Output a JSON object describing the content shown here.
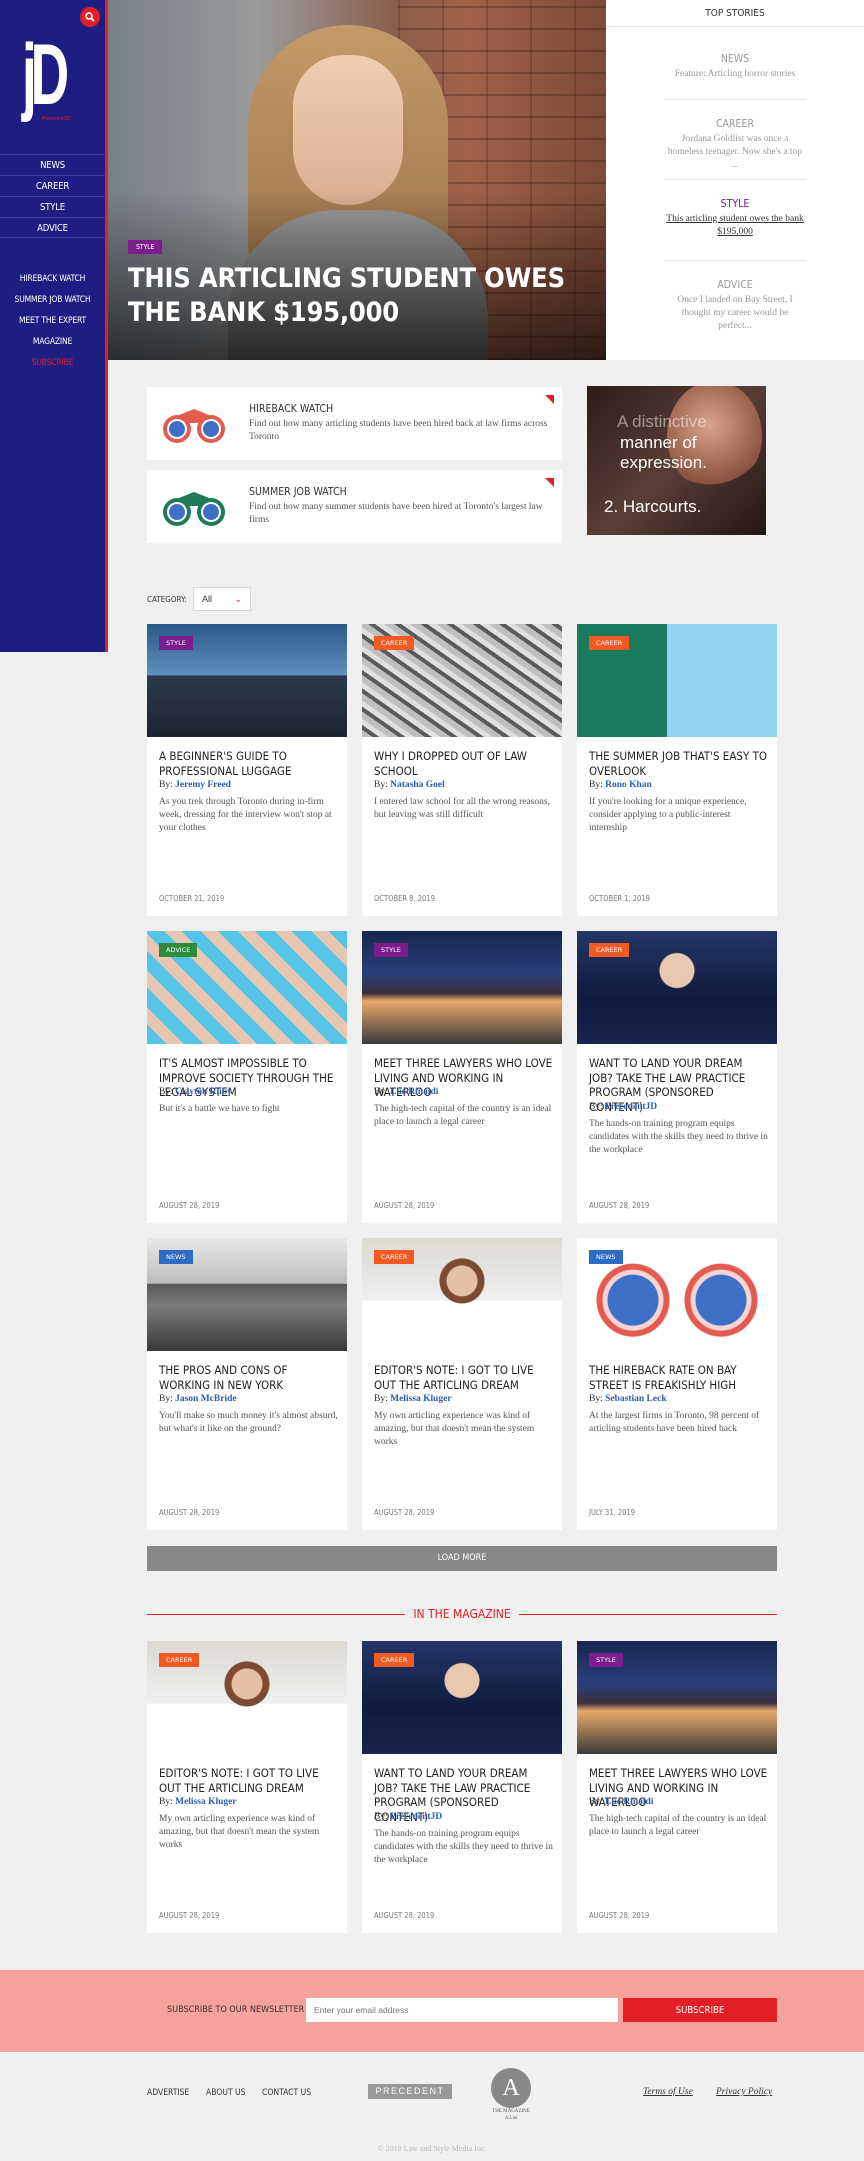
{
  "sidebar": {
    "logo_text": "jD",
    "logo_tag": "PrecedentJD",
    "nav_main": [
      "NEWS",
      "CAREER",
      "STYLE",
      "ADVICE"
    ],
    "nav_secondary": [
      "HIREBACK WATCH",
      "SUMMER JOB WATCH",
      "MEET THE EXPERT",
      "MAGAZINE"
    ],
    "subscribe": "SUBSCRIBE"
  },
  "hero": {
    "badge": "STYLE",
    "title": "THIS ARTICLING STUDENT OWES THE BANK $195,000"
  },
  "top_stories": {
    "heading": "TOP STORIES",
    "items": [
      {
        "category": "NEWS",
        "text": "Feature: Articling horror stories"
      },
      {
        "category": "CAREER",
        "text": "Jordana Goldlist was once a homeless teenager. Now she's a top ..."
      },
      {
        "category": "STYLE",
        "text": "This articling student owes the bank $195,000"
      },
      {
        "category": "ADVICE",
        "text": "Once I landed on Bay Street, I thought my career would be perfect..."
      }
    ]
  },
  "promos": [
    {
      "title": "HIREBACK WATCH",
      "text": "Find out how many articling students have been hired back at law firms across Toronto"
    },
    {
      "title": "SUMMER JOB WATCH",
      "text": "Find out how many summer students have been hired at Toronto's largest law firms"
    }
  ],
  "ad": {
    "line1": "A distinctive",
    "line2": "manner of",
    "line3": "expression.",
    "line4": "2. Harcourts."
  },
  "filter": {
    "label": "CATEGORY:",
    "value": "All"
  },
  "articles": [
    {
      "badge": "STYLE",
      "title": "A BEGINNER'S GUIDE TO PROFESSIONAL LUGGAGE",
      "by": "By:",
      "author": "Jeremy Freed",
      "excerpt": "As you trek through Toronto during in-firm week, dressing for the interview won't stop at your clothes",
      "date": "OCTOBER 21, 2019"
    },
    {
      "badge": "CAREER",
      "title": "WHY I DROPPED OUT OF LAW SCHOOL",
      "by": "By:",
      "author": "Natasha Goel",
      "excerpt": "I entered law school for all the wrong reasons, but leaving was still difficult",
      "date": "OCTOBER 8, 2019"
    },
    {
      "badge": "CAREER",
      "title": "THE SUMMER JOB THAT'S EASY TO OVERLOOK",
      "by": "By:",
      "author": "Rono Khan",
      "excerpt": "If you're looking for a unique experience, consider applying to a public-interest internship",
      "date": "OCTOBER 1, 2019"
    },
    {
      "badge": "ADVICE",
      "title": "IT'S ALMOST IMPOSSIBLE TO IMPROVE SOCIETY THROUGH THE LEGAL SYSTEM",
      "by": "By:",
      "author": "Clayton Ruby",
      "excerpt": "But it's a battle we have to fight",
      "date": "AUGUST 28, 2019"
    },
    {
      "badge": "STYLE",
      "title": "MEET THREE LAWYERS WHO LOVE LIVING AND WORKING IN WATERLOO",
      "by": "By:",
      "author": "Luc Rinaldi",
      "excerpt": "The high-tech capital of the country is an ideal place to launch a legal career",
      "date": "AUGUST 28, 2019"
    },
    {
      "badge": "CAREER",
      "title": "WANT TO LAND YOUR DREAM JOB? TAKE THE LAW PRACTICE PROGRAM (SPONSORED CONTENT)",
      "by": "By:",
      "author": "PrecedentJD",
      "excerpt": "The hands-on training program equips candidates with the skills they need to thrive in the workplace",
      "date": "AUGUST 28, 2019"
    },
    {
      "badge": "NEWS",
      "title": "THE PROS AND CONS OF WORKING IN NEW YORK",
      "by": "By:",
      "author": "Jason McBride",
      "excerpt": "You'll make so much money it's almost absurd, but what's it like on the ground?",
      "date": "AUGUST 28, 2019"
    },
    {
      "badge": "CAREER",
      "title": "EDITOR'S NOTE: I GOT TO LIVE OUT THE ARTICLING DREAM",
      "by": "By:",
      "author": "Melissa Kluger",
      "excerpt": "My own articling experience was kind of amazing, but that doesn't mean the system works",
      "date": "AUGUST 28, 2019"
    },
    {
      "badge": "NEWS",
      "title": "THE HIREBACK RATE ON BAY STREET IS FREAKISHLY HIGH",
      "by": "By:",
      "author": "Sebastian Leck",
      "excerpt": "At the largest firms in Toronto, 98 percent of articling students have been hired back",
      "date": "JULY 31, 2019"
    }
  ],
  "load_more": "LOAD MORE",
  "magazine": {
    "heading": "IN THE MAGAZINE",
    "articles": [
      {
        "badge": "CAREER",
        "title": "EDITOR'S NOTE: I GOT TO LIVE OUT THE ARTICLING DREAM",
        "by": "By:",
        "author": "Melissa Kluger",
        "excerpt": "My own articling experience was kind of amazing, but that doesn't mean the system works",
        "date": "AUGUST 28, 2019"
      },
      {
        "badge": "CAREER",
        "title": "WANT TO LAND YOUR DREAM JOB? TAKE THE LAW PRACTICE PROGRAM (SPONSORED CONTENT)",
        "by": "By:",
        "author": "PrecedentJD",
        "excerpt": "The hands-on training program equips candidates with the skills they need to thrive in the workplace",
        "date": "AUGUST 28, 2019"
      },
      {
        "badge": "STYLE",
        "title": "MEET THREE LAWYERS WHO LOVE LIVING AND WORKING IN WATERLOO",
        "by": "By:",
        "author": "Luc Rinaldi",
        "excerpt": "The high-tech capital of the country is an ideal place to launch a legal career",
        "date": "AUGUST 28, 2019"
      }
    ]
  },
  "newsletter": {
    "label": "SUBSCRIBE TO OUR NEWSLETTER",
    "placeholder": "Enter your email address",
    "button": "SUBSCRIBE"
  },
  "footer": {
    "links": [
      "ADVERTISE",
      "ABOUT US",
      "CONTACT US"
    ],
    "precedent": "PRECEDENT",
    "alist_letter": "A",
    "alist_caption": "A List",
    "alist_sub": "THE MAGAZINE",
    "legal": [
      "Terms of Use",
      "Privacy Policy"
    ],
    "copyright": "© 2019 Law and Style Media Inc."
  },
  "colors": {
    "accent": "#e41e26",
    "sidebar": "#1e1e82",
    "style": "#7b1e8c",
    "career": "#f25a24",
    "news": "#2d6bc4",
    "advice": "#2f8a3c",
    "author": "#2b5fb3"
  }
}
